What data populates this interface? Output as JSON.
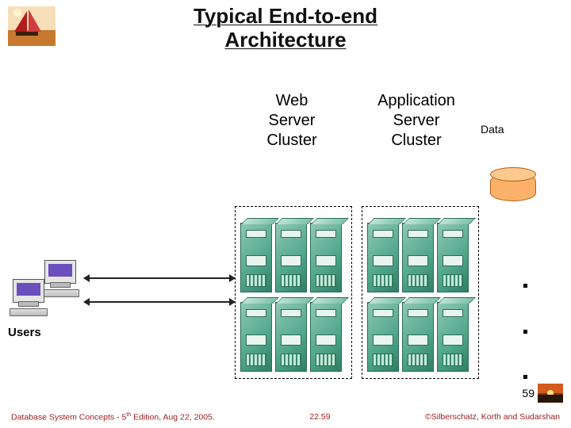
{
  "title": "Typical End-to-end Architecture",
  "columns": {
    "web": "Web\nServer\nCluster",
    "app": "Application\nServer\nCluster",
    "data": "Data"
  },
  "users_label": "Users",
  "page_number_corner": "59",
  "footer": {
    "left_prefix": "Database System Concepts - 5",
    "left_suffix": " Edition, Aug 22, 2005.",
    "left_sup": "th",
    "center": "22.59",
    "right": "©Silberschatz, Korth and Sudarshan"
  }
}
